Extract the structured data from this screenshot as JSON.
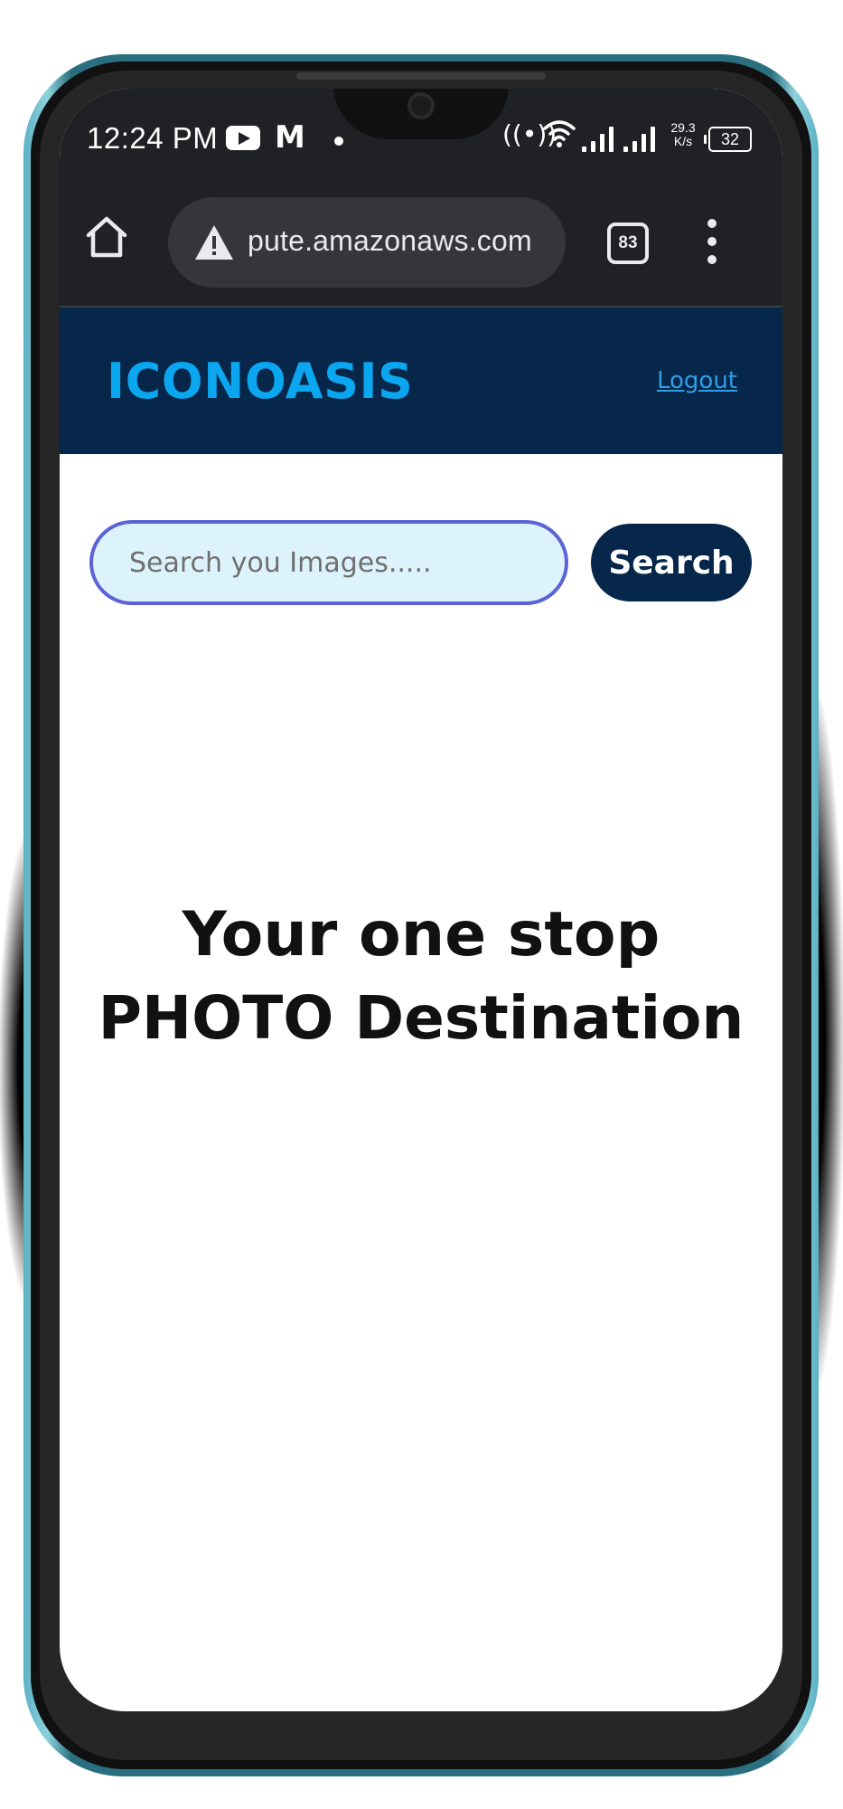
{
  "status_bar": {
    "time": "12:24 PM",
    "network_speed_value": "29.3",
    "network_speed_unit": "K/s",
    "battery": "32",
    "icons": [
      "youtube-icon",
      "gmail-icon",
      "notification-dot-icon",
      "hotspot-icon",
      "wifi-icon",
      "signal-icon",
      "battery-icon"
    ]
  },
  "browser": {
    "url": "pute.amazonaws.com",
    "tab_count": "83",
    "icons": [
      "home-icon",
      "warning-icon",
      "tabs-icon",
      "more-menu-icon"
    ]
  },
  "site": {
    "logo": "ICONOASIS",
    "logout_label": "Logout",
    "search_placeholder": "Search you Images.....",
    "search_button_label": "Search",
    "hero_line_1": "Your one stop",
    "hero_line_2": "PHOTO Destination"
  },
  "colors": {
    "header_bg": "#06274a",
    "logo": "#0aa6f0",
    "link": "#2f9ee6",
    "input_bg": "#ddf3fb",
    "input_border": "#5a63d8",
    "browser_chrome": "#202124"
  }
}
